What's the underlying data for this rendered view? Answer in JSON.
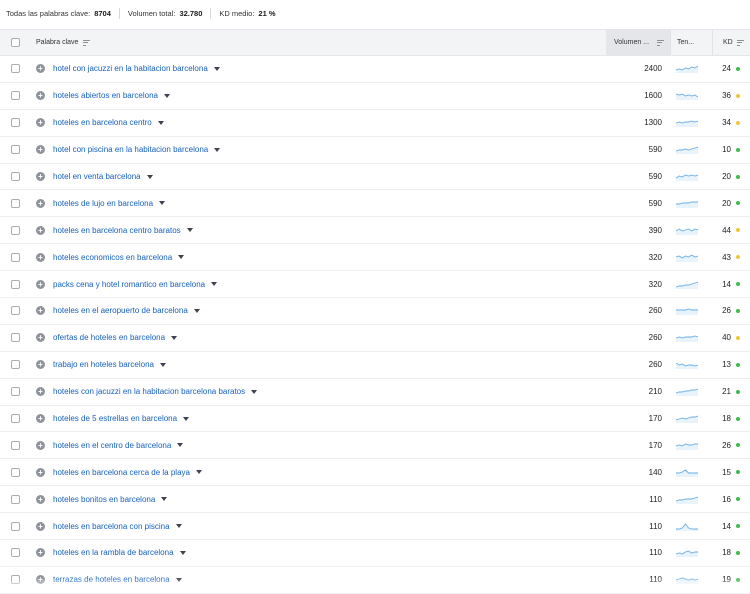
{
  "summary": {
    "total_keywords_label": "Todas las palabras clave:",
    "total_keywords_value": "8704",
    "total_volume_label": "Volumen total:",
    "total_volume_value": "32.780",
    "kd_avg_label": "KD medio:",
    "kd_avg_value": "21 %"
  },
  "headers": {
    "keyword": "Palabra clave",
    "volume": "Volumen ...",
    "trend": "Ten...",
    "kd": "KD"
  },
  "colors": {
    "link": "#1560c0",
    "kd_green": "#3dbb4c",
    "kd_yellow": "#f0c63a",
    "trend_line": "#6aaee6"
  },
  "rows": [
    {
      "keyword": "hotel con jacuzzi en la habitacion barcelona",
      "volume": "2400",
      "kd": "24",
      "kd_level": "green",
      "trend": [
        3,
        4,
        3,
        5,
        4,
        6,
        5,
        7
      ]
    },
    {
      "keyword": "hoteles abiertos en barcelona",
      "volume": "1600",
      "kd": "36",
      "kd_level": "yellow",
      "trend": [
        6,
        5,
        6,
        4,
        5,
        4,
        5,
        3
      ]
    },
    {
      "keyword": "hoteles en barcelona centro",
      "volume": "1300",
      "kd": "34",
      "kd_level": "yellow",
      "trend": [
        4,
        5,
        4,
        5,
        5,
        6,
        5,
        6
      ]
    },
    {
      "keyword": "hotel con piscina en la habitacion barcelona",
      "volume": "590",
      "kd": "10",
      "kd_level": "green",
      "trend": [
        3,
        4,
        4,
        5,
        4,
        5,
        6,
        7
      ]
    },
    {
      "keyword": "hotel en venta barcelona",
      "volume": "590",
      "kd": "20",
      "kd_level": "green",
      "trend": [
        3,
        5,
        4,
        6,
        5,
        6,
        5,
        6
      ]
    },
    {
      "keyword": "hoteles de lujo en barcelona",
      "volume": "590",
      "kd": "20",
      "kd_level": "green",
      "trend": [
        4,
        4,
        5,
        5,
        5,
        6,
        6,
        6
      ]
    },
    {
      "keyword": "hoteles en barcelona centro baratos",
      "volume": "390",
      "kd": "44",
      "kd_level": "yellow",
      "trend": [
        4,
        6,
        4,
        5,
        6,
        4,
        6,
        5
      ]
    },
    {
      "keyword": "hoteles economicos en barcelona",
      "volume": "320",
      "kd": "43",
      "kd_level": "yellow",
      "trend": [
        5,
        6,
        4,
        6,
        5,
        7,
        5,
        6
      ]
    },
    {
      "keyword": "packs cena y hotel romantico en barcelona",
      "volume": "320",
      "kd": "14",
      "kd_level": "green",
      "trend": [
        2,
        3,
        3,
        4,
        4,
        5,
        6,
        7
      ]
    },
    {
      "keyword": "hoteles en el aeropuerto de barcelona",
      "volume": "260",
      "kd": "26",
      "kd_level": "green",
      "trend": [
        5,
        5,
        5,
        5,
        6,
        5,
        5,
        5
      ]
    },
    {
      "keyword": "ofertas de hoteles en barcelona",
      "volume": "260",
      "kd": "40",
      "kd_level": "yellow",
      "trend": [
        4,
        5,
        4,
        5,
        5,
        5,
        6,
        5
      ]
    },
    {
      "keyword": "trabajo en hoteles barcelona",
      "volume": "260",
      "kd": "13",
      "kd_level": "green",
      "trend": [
        6,
        4,
        5,
        3,
        4,
        4,
        3,
        4
      ]
    },
    {
      "keyword": "hoteles con jacuzzi en la habitacion barcelona baratos",
      "volume": "210",
      "kd": "21",
      "kd_level": "green",
      "trend": [
        3,
        4,
        4,
        5,
        5,
        6,
        6,
        7
      ]
    },
    {
      "keyword": "hoteles de 5 estrellas en barcelona",
      "volume": "170",
      "kd": "18",
      "kd_level": "green",
      "trend": [
        3,
        4,
        5,
        4,
        5,
        6,
        6,
        7
      ]
    },
    {
      "keyword": "hoteles en el centro de barcelona",
      "volume": "170",
      "kd": "26",
      "kd_level": "green",
      "trend": [
        4,
        5,
        4,
        6,
        5,
        5,
        6,
        6
      ]
    },
    {
      "keyword": "hoteles en barcelona cerca de la playa",
      "volume": "140",
      "kd": "15",
      "kd_level": "green",
      "trend": [
        4,
        4,
        5,
        7,
        4,
        4,
        4,
        4
      ]
    },
    {
      "keyword": "hoteles bonitos en barcelona",
      "volume": "110",
      "kd": "16",
      "kd_level": "green",
      "trend": [
        3,
        4,
        4,
        5,
        5,
        5,
        6,
        7
      ]
    },
    {
      "keyword": "hoteles en barcelona con piscina",
      "volume": "110",
      "kd": "14",
      "kd_level": "green",
      "trend": [
        2,
        2,
        3,
        7,
        3,
        2,
        2,
        2
      ]
    },
    {
      "keyword": "hoteles en la rambla de barcelona",
      "volume": "110",
      "kd": "18",
      "kd_level": "green",
      "trend": [
        3,
        4,
        3,
        5,
        6,
        4,
        5,
        5
      ]
    },
    {
      "keyword": "terrazas de hoteles en barcelona",
      "volume": "110",
      "kd": "19",
      "kd_level": "green",
      "trend": [
        4,
        5,
        6,
        5,
        4,
        5,
        4,
        5
      ]
    }
  ]
}
